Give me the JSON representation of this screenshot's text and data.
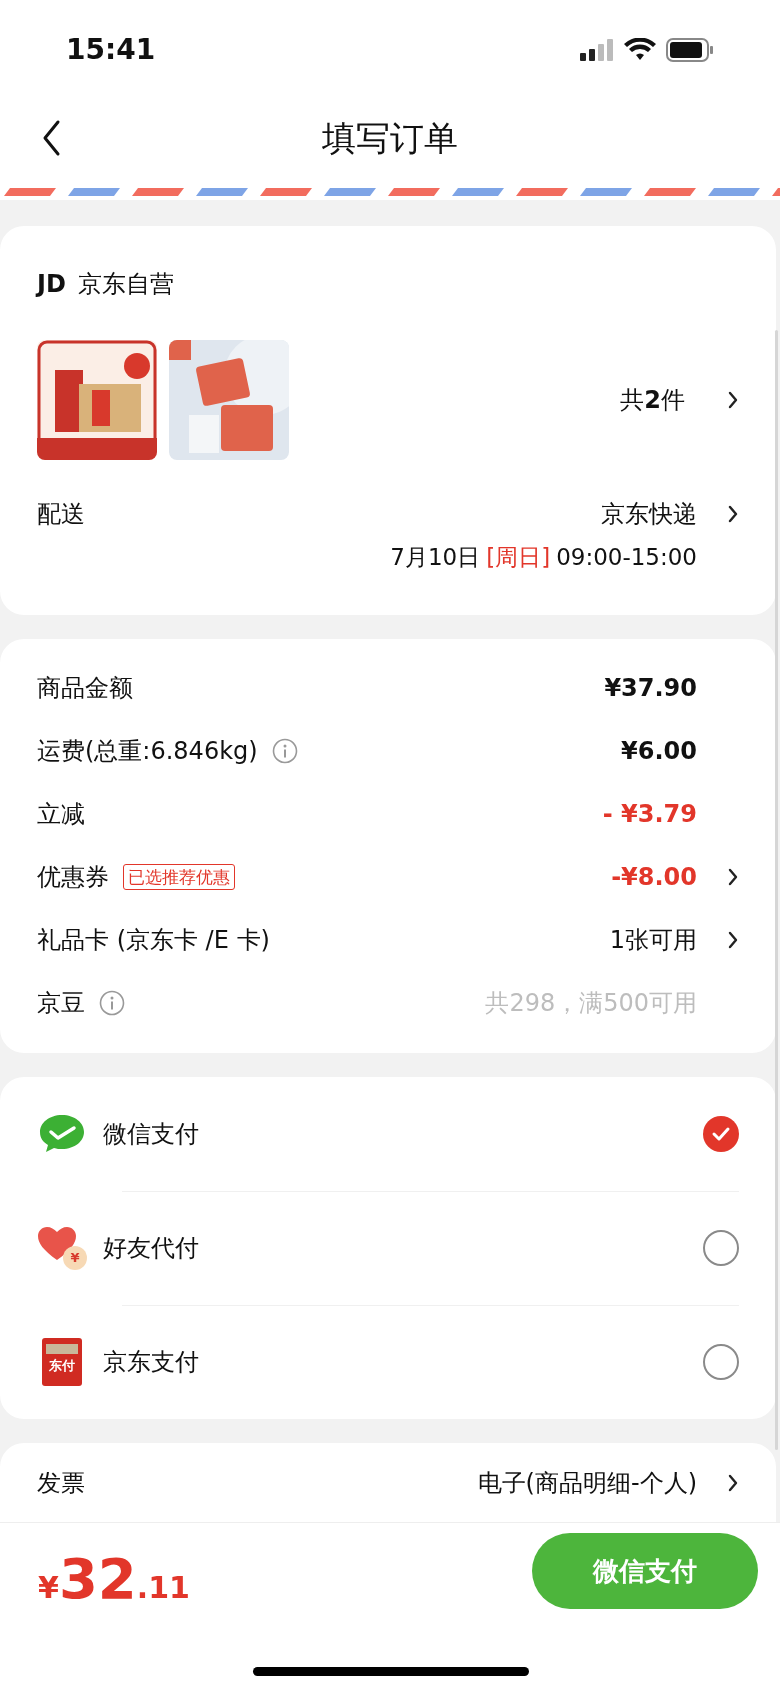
{
  "status_bar": {
    "time": "15:41"
  },
  "header": {
    "title": "填写订单"
  },
  "store": {
    "logo": "JD",
    "name": "京东自营",
    "count": "共**2**件"
  },
  "delivery": {
    "label": "配送",
    "carrier": "京东快递",
    "date": "7月10日",
    "weekday": "[周日]",
    "time": "09:00-15:00"
  },
  "fees": [
    {
      "label": "商品金额",
      "value": "¥37.90",
      "kind": "amount",
      "info": false,
      "chevron": false
    },
    {
      "label": "运费(总重:6.846kg)",
      "value": "¥6.00",
      "kind": "amount",
      "info": true,
      "chevron": false
    },
    {
      "label": "立减",
      "value": "- ¥3.79",
      "kind": "discount",
      "info": false,
      "chevron": false
    },
    {
      "label": "优惠券",
      "tag": "已选推荐优惠",
      "value": "-¥8.00",
      "kind": "discount",
      "info": false,
      "chevron": true
    },
    {
      "label": "礼品卡 (京东卡 /E 卡)",
      "value": "1张可用",
      "kind": "option",
      "info": false,
      "chevron": true
    },
    {
      "label": "京豆",
      "value": "共298，满500可用",
      "kind": "unavailable",
      "info": true,
      "chevron": false
    }
  ],
  "payments": [
    {
      "kind": "wechat",
      "name": "微信支付",
      "selected": true
    },
    {
      "kind": "friend",
      "name": "好友代付",
      "icon_text": "¥",
      "selected": false
    },
    {
      "kind": "jdpay",
      "name": "京东支付",
      "icon_text": "东付",
      "selected": false
    }
  ],
  "invoice": {
    "label": "发票",
    "value": "电子(商品明细-个人)"
  },
  "footer": {
    "currency": "¥",
    "integer": "32",
    "decimal": ".11",
    "button": "微信支付"
  }
}
